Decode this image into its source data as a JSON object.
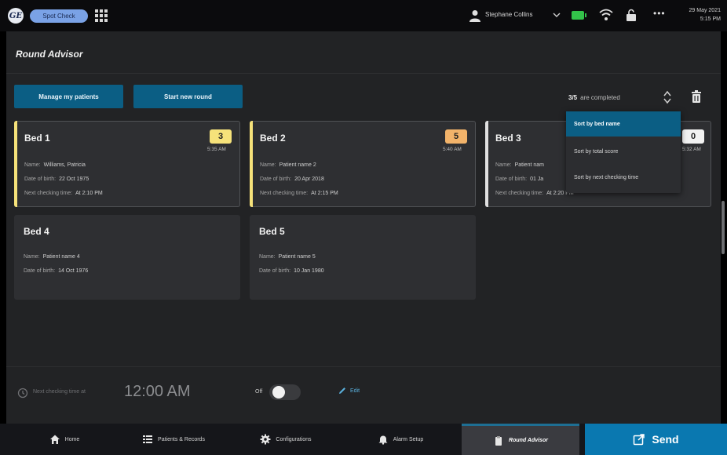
{
  "topbar": {
    "logo_text": "GE",
    "app_pill": "Spot Check",
    "user_name": "Stephane Collins",
    "date": "29 May 2021",
    "time": "5:15 PM"
  },
  "page": {
    "title": "Round Advisor",
    "manage_button": "Manage my patients",
    "start_button": "Start new round",
    "completed_count": "3/5",
    "completed_text": "are completed"
  },
  "labels": {
    "name": "Name:",
    "dob": "Date of birth:",
    "next": "Next checking time:"
  },
  "beds": [
    {
      "bed": "Bed 1",
      "name": "Williams, Patricia",
      "dob": "22 Oct 1975",
      "next": "At 2:10 PM",
      "score": "3",
      "score_color": "#f6e27a",
      "time": "5:35 AM",
      "accent": "#f6e27a"
    },
    {
      "bed": "Bed 2",
      "name": "Patient name 2",
      "dob": "20 Apr 2018",
      "next": "At 2:15 PM",
      "score": "5",
      "score_color": "#f2b36a",
      "time": "5:40 AM",
      "accent": "#f6e27a"
    },
    {
      "bed": "Bed 3",
      "name": "Patient nam",
      "dob": "01 Ja",
      "next": "At 2:20 PM",
      "score": "0",
      "score_color": "#f2f2f2",
      "time": "5:32 AM",
      "accent": "#e0e0e0"
    },
    {
      "bed": "Bed 4",
      "name": "Patient name 4",
      "dob": "14 Oct 1976"
    },
    {
      "bed": "Bed 5",
      "name": "Patient name 5",
      "dob": "10 Jan 1980"
    }
  ],
  "sort_menu": {
    "items": [
      "Sort by bed name",
      "Sort by total score",
      "Sort by next checking time"
    ],
    "selected_index": 0
  },
  "footer": {
    "next_label": "Next checking time at",
    "next_time": "12:00 AM",
    "toggle_label": "Off",
    "toggle_on": false,
    "edit_label": "Edit"
  },
  "nav": {
    "home": "Home",
    "patients": "Patients & Records",
    "config": "Configurations",
    "alarm": "Alarm Setup",
    "round": "Round Advisor",
    "send": "Send"
  },
  "colors": {
    "accent_blue": "#0b5e84",
    "send_blue": "#0a78b0",
    "background": "#222325"
  }
}
